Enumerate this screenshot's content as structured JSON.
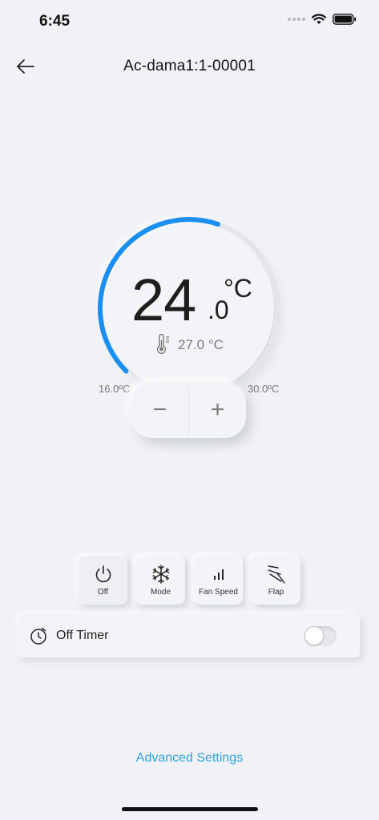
{
  "status_bar": {
    "time": "6:45"
  },
  "header": {
    "title": "Ac-dama1:1-00001"
  },
  "thermostat": {
    "set_temp_int": "24",
    "set_temp_dec": ".0",
    "unit": "°C",
    "room_temp": "27.0 °C",
    "min_label": "16.0ºC",
    "max_label": "30.0ºC",
    "setpoint_fraction": 0.57,
    "arc_color": "#1a8ff0",
    "track_color": "#e4e5ea"
  },
  "stepper": {
    "minus": "−",
    "plus": "+"
  },
  "controls": [
    {
      "label": "Off",
      "icon": "power-icon"
    },
    {
      "label": "Mode",
      "icon": "snowflake-icon"
    },
    {
      "label": "Fan Speed",
      "icon": "fan-speed-icon"
    },
    {
      "label": "Flap",
      "icon": "flap-icon"
    }
  ],
  "timer": {
    "label": "Off Timer",
    "enabled": false
  },
  "advanced": {
    "label": "Advanced Settings",
    "color": "#2aa3de"
  }
}
